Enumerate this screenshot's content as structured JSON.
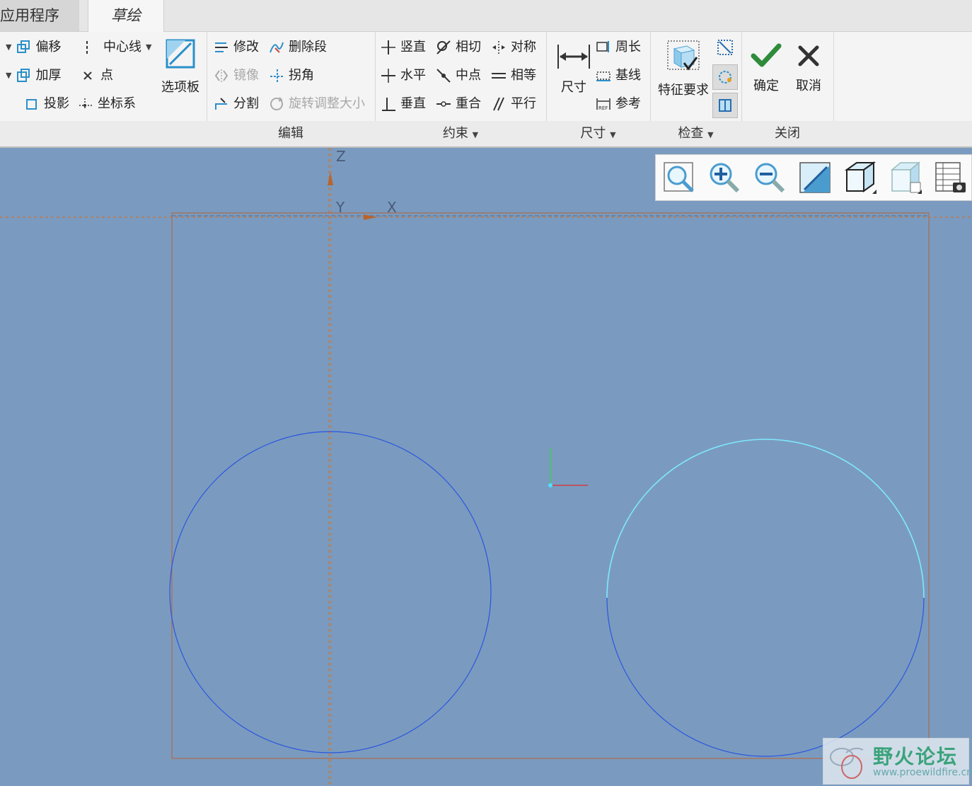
{
  "tabs": {
    "apps": "应用程序",
    "sketch": "草绘"
  },
  "setup_group": {
    "offset": "偏移",
    "centerline": "中心线",
    "thicken": "加厚",
    "point": "点",
    "project": "投影",
    "coordsys": "坐标系",
    "palette": "选项板"
  },
  "edit_group": {
    "title": "编辑",
    "modify": "修改",
    "delete_segment": "删除段",
    "mirror": "镜像",
    "corner": "拐角",
    "divide": "分割",
    "rotate_resize": "旋转调整大小"
  },
  "constrain_group": {
    "title": "约束",
    "vertical": "竖直",
    "tangent": "相切",
    "symmetric": "对称",
    "horizontal": "水平",
    "midpoint": "中点",
    "equal": "相等",
    "perpendicular": "垂直",
    "coincident": "重合",
    "parallel": "平行"
  },
  "dimension_group": {
    "title": "尺寸",
    "dimension": "尺寸",
    "perimeter": "周长",
    "baseline": "基线",
    "reference": "参考"
  },
  "inspect_group": {
    "title": "检查",
    "feature_req": "特征要求"
  },
  "close_group": {
    "title": "关闭",
    "ok": "确定",
    "cancel": "取消"
  },
  "axes": {
    "z": "Z",
    "y": "Y",
    "x": "X"
  },
  "watermark": {
    "title": "野火论坛",
    "url": "www.proewildfire.cn"
  },
  "colors": {
    "canvas": "#7a9bbf",
    "accent": "#2a8fc9",
    "sketch_line": "#2a55e0",
    "selected": "#7fe8ff",
    "reference": "#c8743a"
  }
}
